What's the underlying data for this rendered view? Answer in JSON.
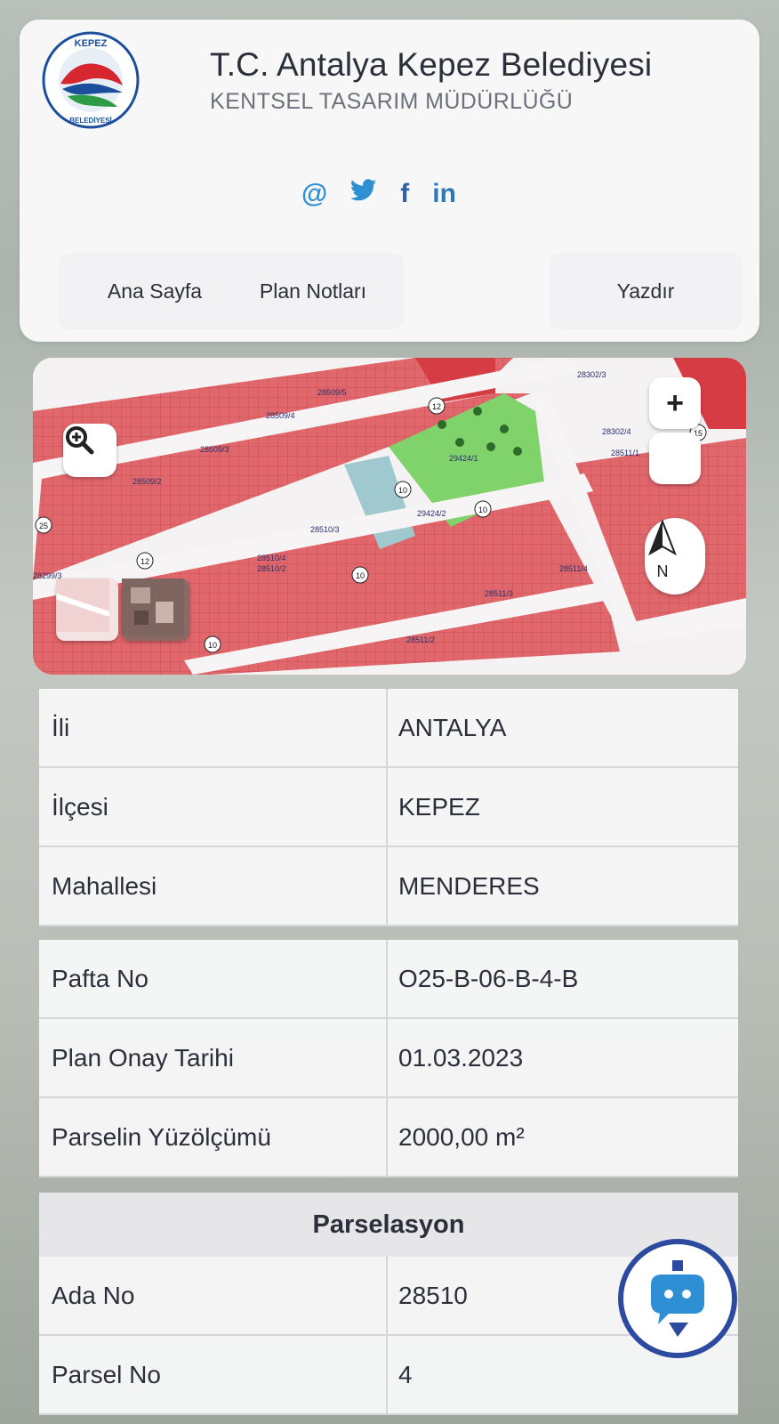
{
  "header": {
    "title": "T.C. Antalya Kepez Belediyesi",
    "subtitle": "KENTSEL TASARIM MÜDÜRLÜĞÜ",
    "logo_text_top": "KEPEZ",
    "logo_text_bottom": "BELEDİYESİ",
    "social": [
      {
        "icon": "email-icon",
        "glyph": "@"
      },
      {
        "icon": "twitter-icon",
        "glyph": "🐦"
      },
      {
        "icon": "facebook-icon",
        "glyph": "f"
      },
      {
        "icon": "linkedin-icon",
        "glyph": "in"
      }
    ],
    "nav": {
      "home": "Ana Sayfa",
      "plan_notes": "Plan Notları",
      "print": "Yazdır"
    }
  },
  "map": {
    "zoom_in": "+",
    "compass_label": "N",
    "parcel_labels": [
      "28302/3",
      "28302/4",
      "28509/5",
      "28509/4",
      "28509/3",
      "28509/2",
      "28510/3",
      "28510/2",
      "28510/4",
      "28511/4",
      "28511/3",
      "28511/2",
      "28511/1",
      "29424/1",
      "29424/2",
      "28299/3"
    ],
    "road_labels": [
      "12",
      "10",
      "10",
      "12",
      "10",
      "10",
      "15",
      "25"
    ]
  },
  "info": {
    "rows": [
      {
        "label": "İli",
        "value": "ANTALYA"
      },
      {
        "label": "İlçesi",
        "value": "KEPEZ"
      },
      {
        "label": "Mahallesi",
        "value": "MENDERES"
      }
    ],
    "plan_rows": [
      {
        "label": "Pafta No",
        "value": "O25-B-06-B-4-B"
      },
      {
        "label": "Plan Onay Tarihi",
        "value": "01.03.2023"
      },
      {
        "label": "Parselin Yüzölçümü",
        "value": "2000,00 m²"
      }
    ],
    "section_title": "Parselasyon",
    "parcel_rows": [
      {
        "label": "Ada No",
        "value": "28510"
      },
      {
        "label": "Parsel No",
        "value": "4"
      }
    ]
  },
  "colors": {
    "accent_blue": "#2f8fd4",
    "parcel_red": "#e0676b",
    "park_green": "#7fd36a"
  }
}
